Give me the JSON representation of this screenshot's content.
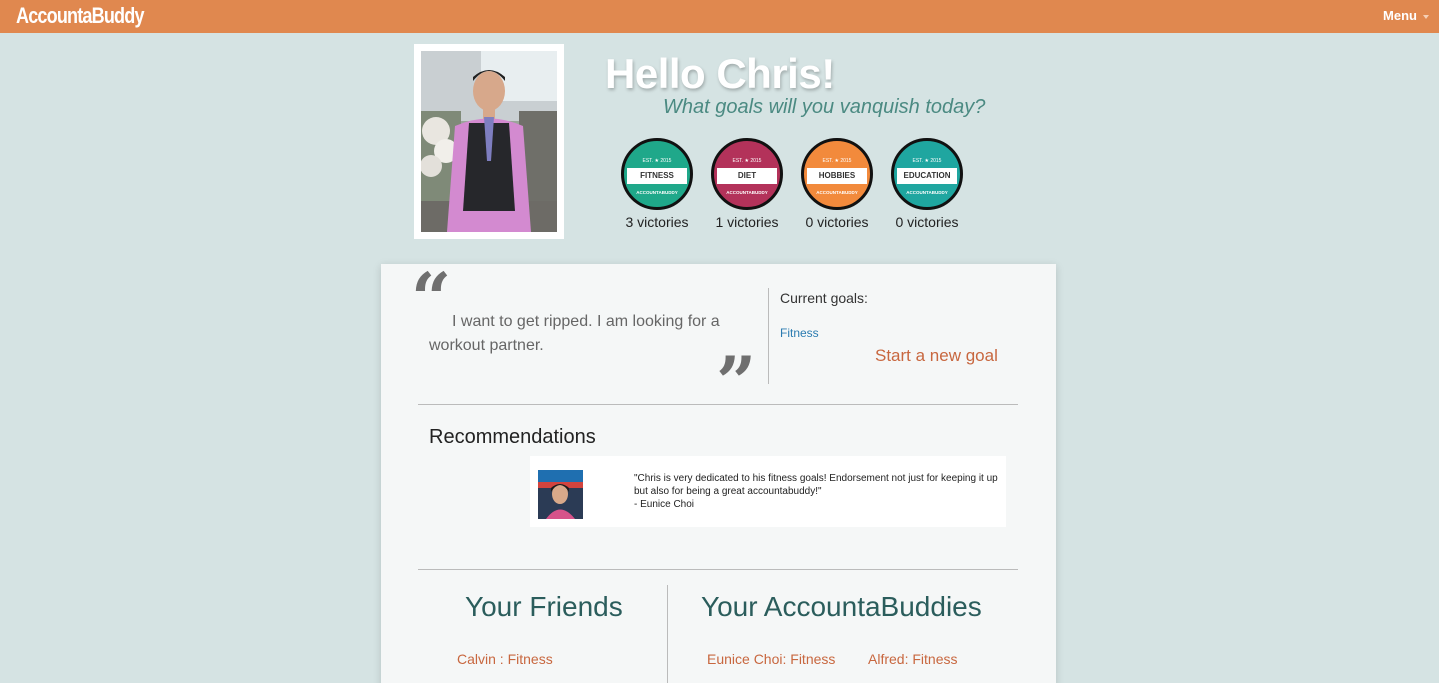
{
  "navbar": {
    "brand": "AccountaBuddy",
    "menu_label": "Menu"
  },
  "profile": {
    "greeting": "Hello Chris!",
    "tagline": "What goals will you vanquish today?"
  },
  "badges": [
    {
      "name": "FITNESS",
      "color": "#1fa88a",
      "victories": "3 victories"
    },
    {
      "name": "DIET",
      "color": "#b3325a",
      "victories": "1 victories"
    },
    {
      "name": "HOBBIES",
      "color": "#f28a3c",
      "victories": "0 victories"
    },
    {
      "name": "EDUCATION",
      "color": "#1fa6a0",
      "victories": "0 victories"
    }
  ],
  "bio": {
    "quote": "I want to get ripped. I am looking for a workout partner.",
    "current_goals_label": "Current goals:",
    "goals": [
      "Fitness"
    ],
    "new_goal_link": "Start a new goal"
  },
  "recommendations": {
    "title": "Recommendations",
    "items": [
      {
        "text": "\"Chris is very dedicated to his fitness goals! Endorsement not just for keeping it up but also for being a great accountabuddy!\"",
        "author": "- Eunice Choi"
      }
    ]
  },
  "friends": {
    "title": "Your Friends",
    "items": [
      "Calvin : Fitness"
    ]
  },
  "buddies": {
    "title": "Your AccountaBuddies",
    "items": [
      "Eunice Choi: Fitness",
      "Alfred: Fitness"
    ]
  },
  "colors": {
    "nav": "#e0884f",
    "background": "#d5e3e3",
    "accent_link": "#c8673f",
    "heading_teal": "#2b5d5c"
  }
}
